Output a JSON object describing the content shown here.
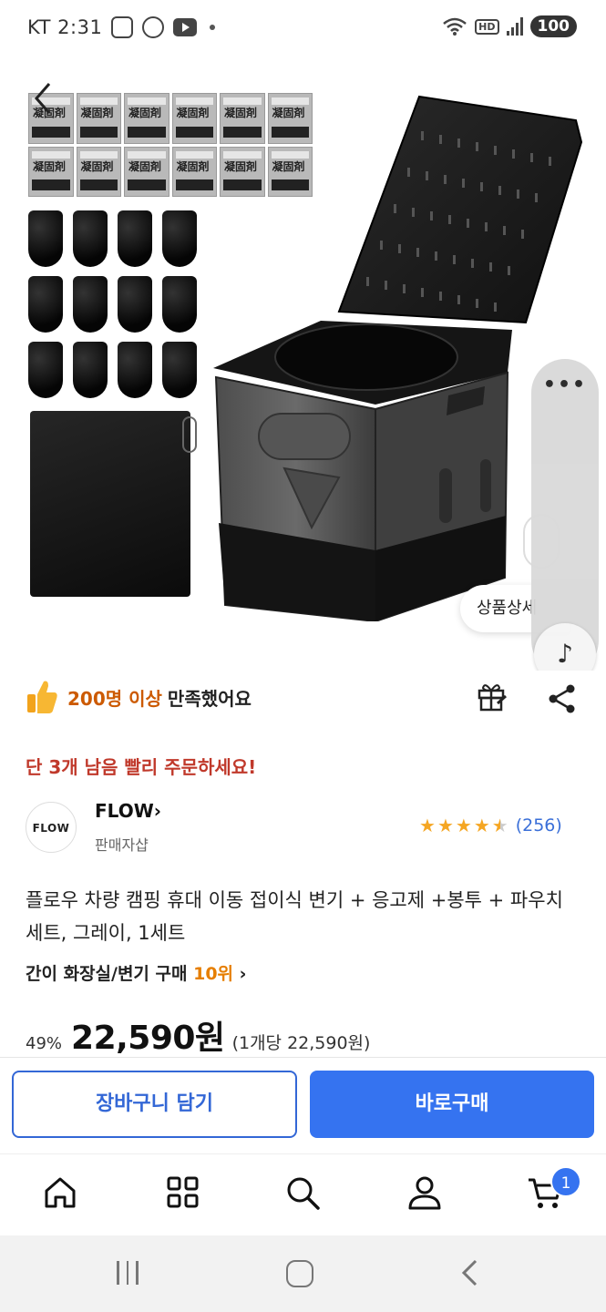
{
  "status_bar": {
    "carrier_time": "KT 2:31",
    "hd_label": "HD",
    "battery": "100"
  },
  "hero": {
    "packet_label": "凝固剤",
    "detail_chip_label": "상품상세"
  },
  "satisfaction": {
    "highlight": "200명 이상",
    "rest": "만족했어요"
  },
  "stock_notice": "단 3개 남음 빨리 주문하세요!",
  "seller": {
    "logo_text": "FLOW",
    "name": "FLOW",
    "name_chevron": "›",
    "subtitle": "판매자샵",
    "rating_value": 4.5,
    "rating_count": "(256)"
  },
  "product": {
    "title": "플로우 차량 캠핑 휴대 이동 접이식 변기 + 응고제 +봉투 + 파우치 세트, 그레이, 1세트",
    "rank_category": "간이 화장실/변기 구매 ",
    "rank_number": "10위",
    "rank_chevron": " ›",
    "discount": "49%",
    "price": "22,590원",
    "unit_price": "(1개당 22,590원)"
  },
  "actions": {
    "add_to_cart": "장바구니 담기",
    "buy_now": "바로구매"
  },
  "bottom_nav": {
    "cart_badge": "1",
    "items": [
      "home-icon",
      "grid-icon",
      "search-icon",
      "person-icon",
      "cart-icon"
    ]
  },
  "colors": {
    "accent_blue": "#3573f0",
    "stock_red": "#c0392b",
    "rank_orange": "#e67e00",
    "satisfy_orange": "#cc5a00",
    "star": "#f5a623"
  }
}
